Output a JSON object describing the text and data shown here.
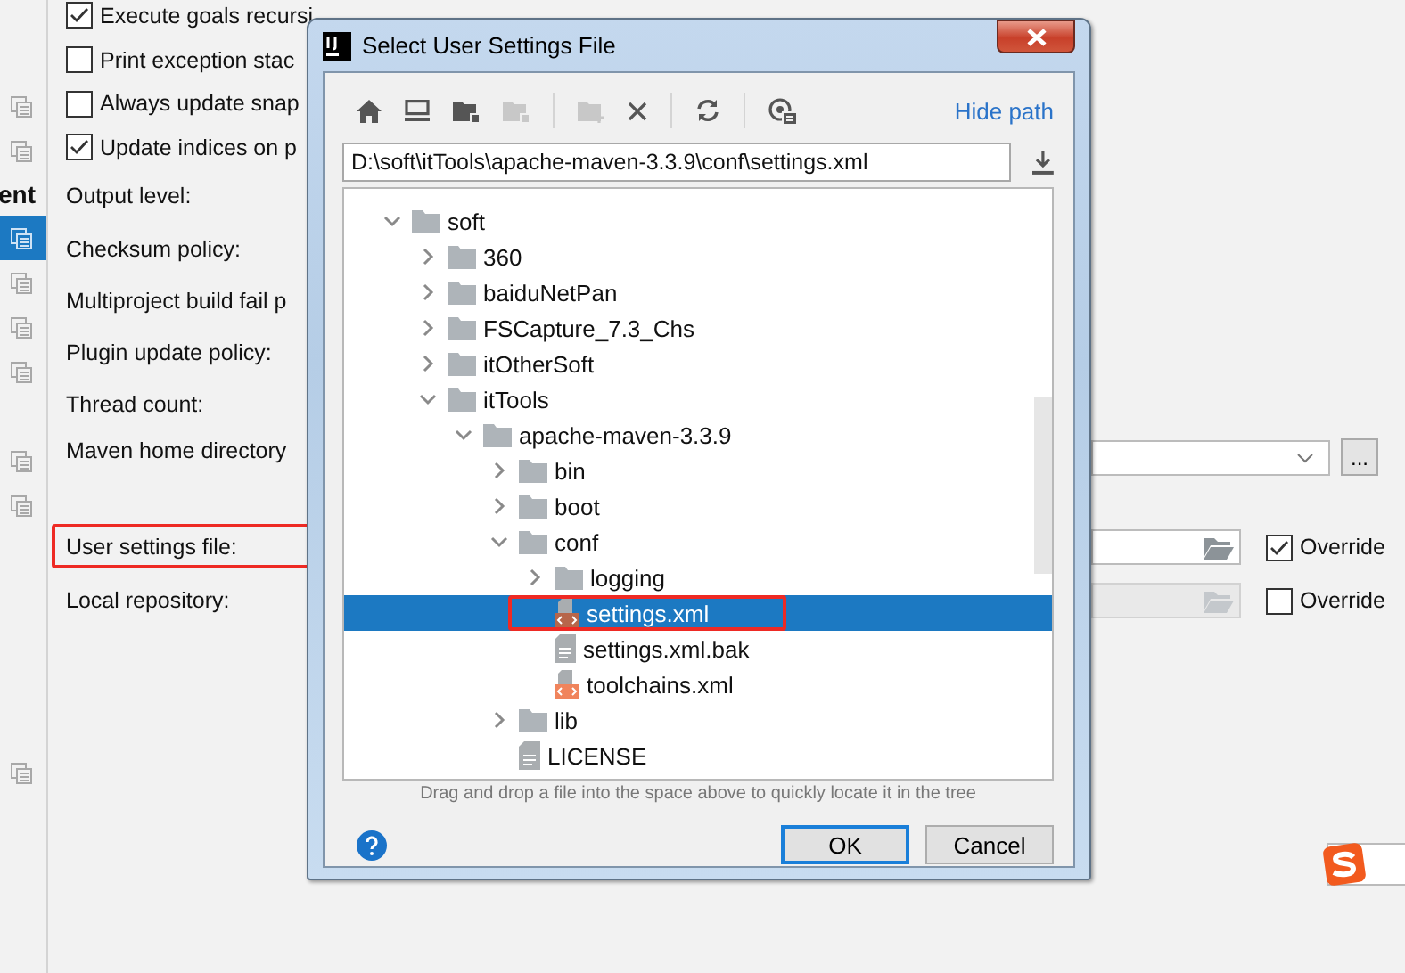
{
  "sidebar": {
    "cut_label": "ent",
    "items": [
      {
        "selected": false
      },
      {
        "selected": false
      },
      {
        "selected": true
      },
      {
        "selected": false
      },
      {
        "selected": false
      },
      {
        "selected": false
      },
      {
        "selected": false
      },
      {
        "selected": false
      },
      {
        "selected": false
      }
    ]
  },
  "settings": {
    "checkboxes": [
      {
        "label": "Execute goals recursi",
        "checked": true
      },
      {
        "label": "Print exception stac",
        "checked": false
      },
      {
        "label": "Always update snap",
        "checked": false
      },
      {
        "label": "Update indices on p",
        "checked": true
      }
    ],
    "fields": [
      {
        "label": "Output level:",
        "kind": "plain"
      },
      {
        "label": "Checksum policy:",
        "kind": "plain"
      },
      {
        "label": "Multiproject build fail p",
        "kind": "plain"
      },
      {
        "label": "Plugin update policy:",
        "kind": "plain"
      },
      {
        "label": "Thread count:",
        "kind": "plain"
      },
      {
        "label": "Maven home directory",
        "kind": "dropdown",
        "button": "..."
      },
      {
        "label": "User settings file:",
        "kind": "file",
        "highlighted": true,
        "disabled": false,
        "override": {
          "label": "Override",
          "checked": true
        }
      },
      {
        "label": "Local repository:",
        "kind": "file",
        "disabled": true,
        "override": {
          "label": "Override",
          "checked": false
        }
      }
    ]
  },
  "dialog": {
    "title": "Select User Settings File",
    "hide_path": "Hide path",
    "path": "D:\\soft\\itTools\\apache-maven-3.3.9\\conf\\settings.xml",
    "tree": [
      {
        "name": "soft",
        "kind": "folder",
        "expanded": true,
        "children": [
          {
            "name": "360",
            "kind": "folder",
            "expanded": false
          },
          {
            "name": "baiduNetPan",
            "kind": "folder",
            "expanded": false
          },
          {
            "name": "FSCapture_7.3_Chs",
            "kind": "folder",
            "expanded": false
          },
          {
            "name": "itOtherSoft",
            "kind": "folder",
            "expanded": false
          },
          {
            "name": "itTools",
            "kind": "folder",
            "expanded": true,
            "children": [
              {
                "name": "apache-maven-3.3.9",
                "kind": "folder",
                "expanded": true,
                "children": [
                  {
                    "name": "bin",
                    "kind": "folder",
                    "expanded": false
                  },
                  {
                    "name": "boot",
                    "kind": "folder",
                    "expanded": false
                  },
                  {
                    "name": "conf",
                    "kind": "folder",
                    "expanded": true,
                    "children": [
                      {
                        "name": "logging",
                        "kind": "folder",
                        "expanded": false
                      },
                      {
                        "name": "settings.xml",
                        "kind": "xml",
                        "selected": true,
                        "highlighted": true
                      },
                      {
                        "name": "settings.xml.bak",
                        "kind": "text",
                        "selected": false
                      },
                      {
                        "name": "toolchains.xml",
                        "kind": "xml",
                        "selected": false
                      }
                    ]
                  },
                  {
                    "name": "lib",
                    "kind": "folder",
                    "expanded": false
                  },
                  {
                    "name": "LICENSE",
                    "kind": "text",
                    "selected": false
                  }
                ]
              }
            ]
          }
        ]
      }
    ],
    "hint": "Drag and drop a file into the space above to quickly locate it in the tree",
    "buttons": [
      {
        "label": "OK",
        "default": true
      },
      {
        "label": "Cancel",
        "default": false
      }
    ]
  }
}
